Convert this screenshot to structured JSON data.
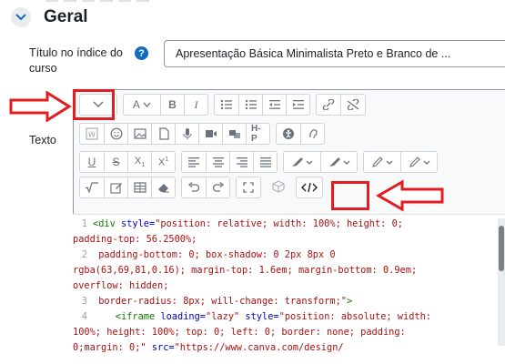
{
  "section": {
    "title": "Geral"
  },
  "fields": {
    "title_label": "Título no índice do curso",
    "help_icon_glyph": "?",
    "title_value": "Apresentação Básica Minimalista Preto e Branco de ...",
    "text_label": "Texto"
  },
  "toolbar": {
    "row1": [
      "toggle",
      "paragraph",
      "bold",
      "italic",
      "unordered-list",
      "ordered-list",
      "outdent",
      "indent",
      "link",
      "unlink"
    ],
    "paragraph_label": "A",
    "bold_label": "B",
    "italic_label": "I",
    "h5p_label": "H-P"
  },
  "code_lines": {
    "l1_num": "1",
    "l1a_tag": "<div ",
    "l1a_attr": "style=",
    "l1a_str": "\"position: relative; width: 100%; height: 0;",
    "l1b": "padding-top: 56.2500%;",
    "l2_num": "2",
    "l2a": " padding-bottom: 0; box-shadow: 0 2px 8px 0",
    "l2b": "rgba(63,69,81,0.16); margin-top: 1.6em; margin-bottom: 0.9em;",
    "l2c": "overflow: hidden;",
    "l3_num": "3",
    "l3a_str": " border-radius: 8px; will-change: transform;\"",
    "l3a_tag": ">",
    "l4_num": "4",
    "l4a_tag": "    <iframe ",
    "l4a_attr": "loading=",
    "l4a_str": "\"lazy\" ",
    "l4a_attr2": "style=",
    "l4a_str2": "\"position: absolute; width:",
    "l4b": "100%; height: 100%; top: 0; left: 0; border: none; padding:",
    "l4c_str": "0;margin: 0;\" ",
    "l4c_attr": "src=",
    "l4c_str2": "\"https://www.canva.com/design/"
  },
  "colors": {
    "accent": "#0f6cbf",
    "highlight": "#e11d21"
  }
}
